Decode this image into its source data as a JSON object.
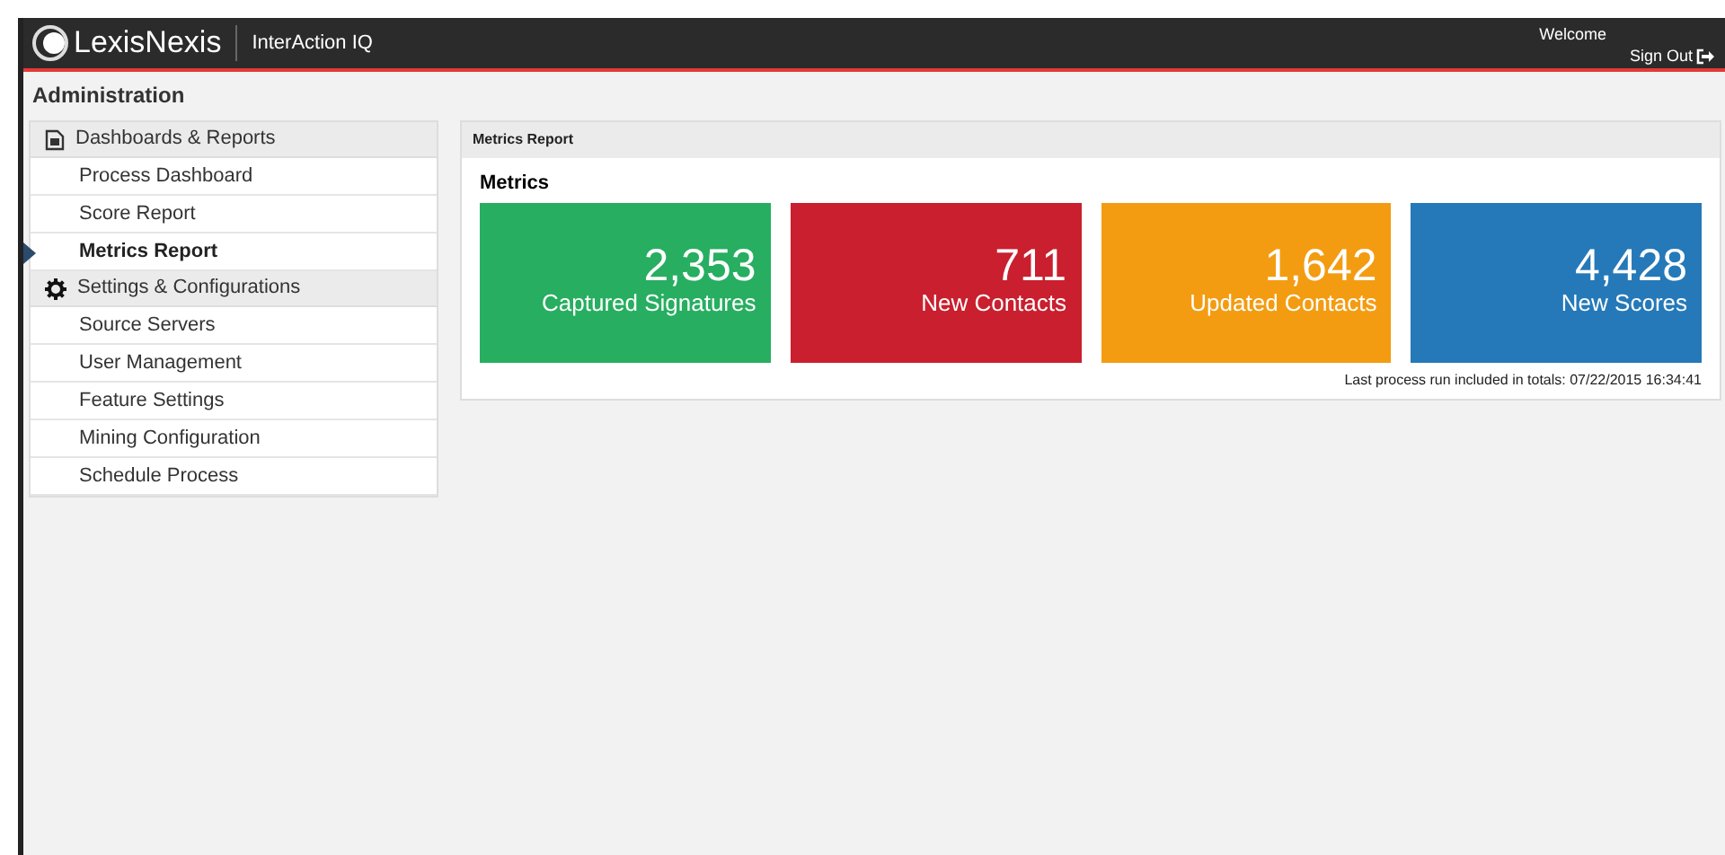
{
  "header": {
    "logo": "LexisNexis",
    "product": "InterAction IQ",
    "welcome": "Welcome",
    "sign_out": "Sign Out"
  },
  "page_title": "Administration",
  "sidebar": {
    "sections": [
      {
        "kind": "reports",
        "label": "Dashboards & Reports",
        "items": [
          {
            "label": "Process Dashboard",
            "selected": false
          },
          {
            "label": "Score Report",
            "selected": false
          },
          {
            "label": "Metrics Report",
            "selected": true
          }
        ]
      },
      {
        "kind": "settings",
        "label": "Settings & Configurations",
        "items": [
          {
            "label": "Source Servers",
            "selected": false
          },
          {
            "label": "User Management",
            "selected": false
          },
          {
            "label": "Feature Settings",
            "selected": false
          },
          {
            "label": "Mining Configuration",
            "selected": false
          },
          {
            "label": "Schedule Process",
            "selected": false
          }
        ]
      }
    ]
  },
  "panel": {
    "title": "Metrics Report",
    "heading": "Metrics",
    "tiles": [
      {
        "value": "2,353",
        "label": "Captured Signatures",
        "color": "#27ae60"
      },
      {
        "value": "711",
        "label": "New Contacts",
        "color": "#c91f2e"
      },
      {
        "value": "1,642",
        "label": "Updated Contacts",
        "color": "#f39c12"
      },
      {
        "value": "4,428",
        "label": "New Scores",
        "color": "#2579b8"
      }
    ],
    "footnote": "Last process run included in totals: 07/22/2015 16:34:41"
  }
}
